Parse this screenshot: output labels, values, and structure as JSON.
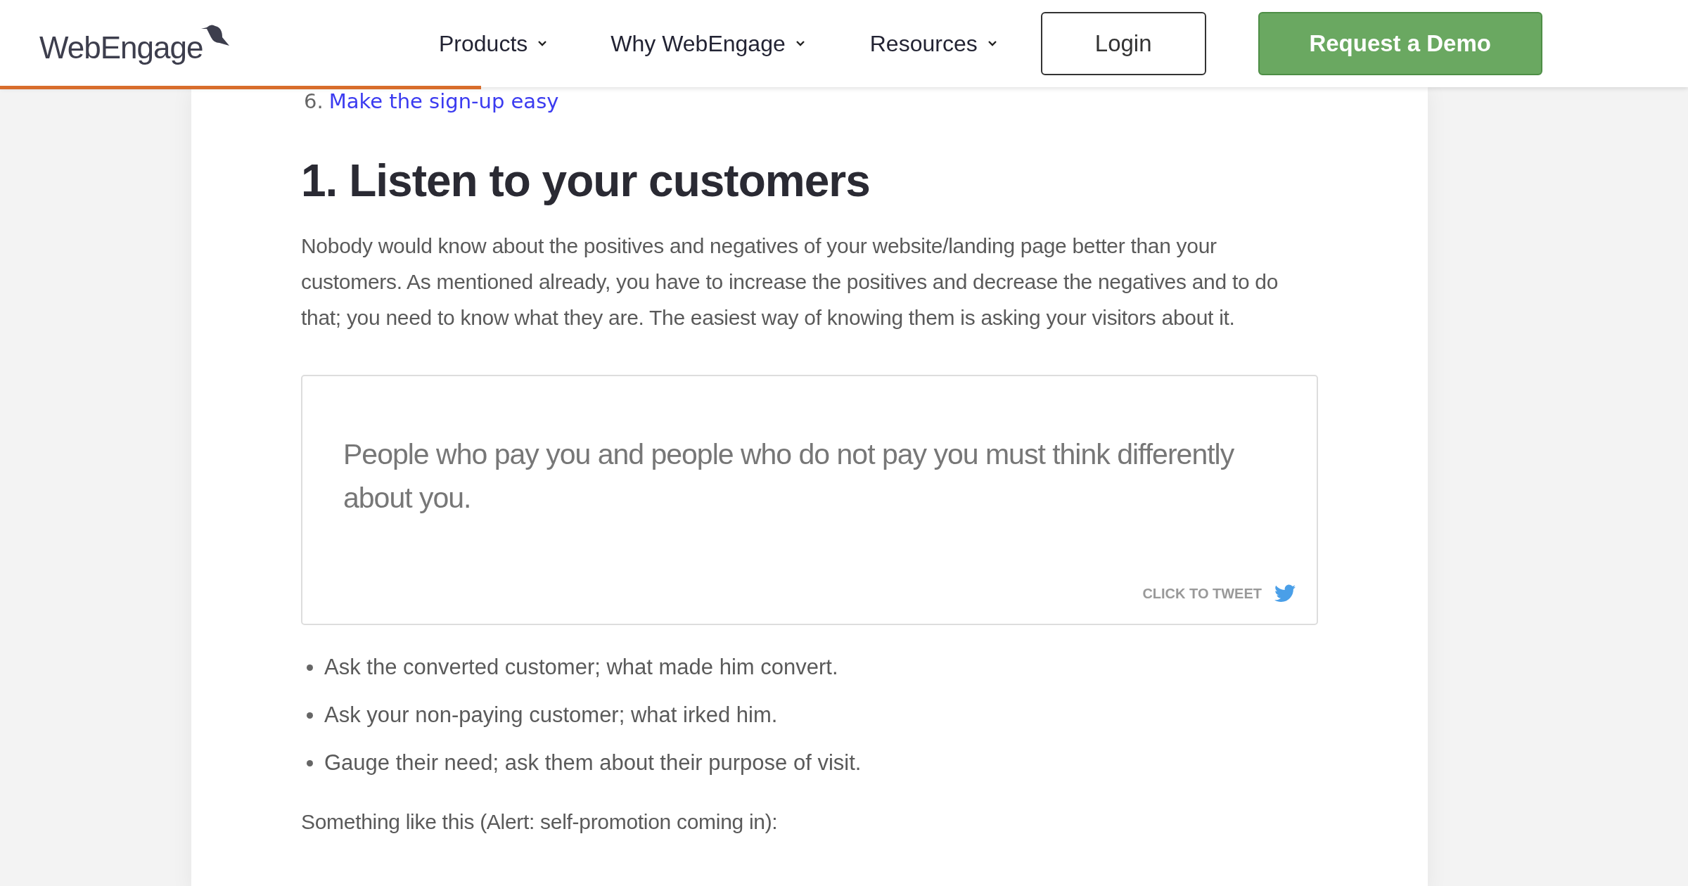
{
  "header": {
    "logo": "WebEngage",
    "nav": [
      {
        "label": "Products"
      },
      {
        "label": "Why WebEngage"
      },
      {
        "label": "Resources"
      }
    ],
    "login": "Login",
    "demo": "Request a Demo"
  },
  "reading_progress": {
    "level": 0.285
  },
  "article": {
    "toc_item": {
      "number": "6.",
      "link": "Make the sign-up easy"
    },
    "heading": "1. Listen to your customers",
    "paragraph": "Nobody would know about the positives and negatives of your website/landing page better than your customers. As mentioned already, you have to increase the positives and decrease the negatives and to do that; you need to know what they are. The easiest way of knowing them is asking your visitors about it.",
    "tweet": {
      "quote": "People who pay you and people who do not pay you must think differently about you.",
      "cta": "CLICK TO TWEET"
    },
    "bullets": [
      "Ask the converted customer; what made him convert.",
      "Ask your non-paying customer; what irked him.",
      "Gauge their need; ask them about their purpose of visit."
    ],
    "closing": "Something like this (Alert: self-promotion coming in):"
  }
}
